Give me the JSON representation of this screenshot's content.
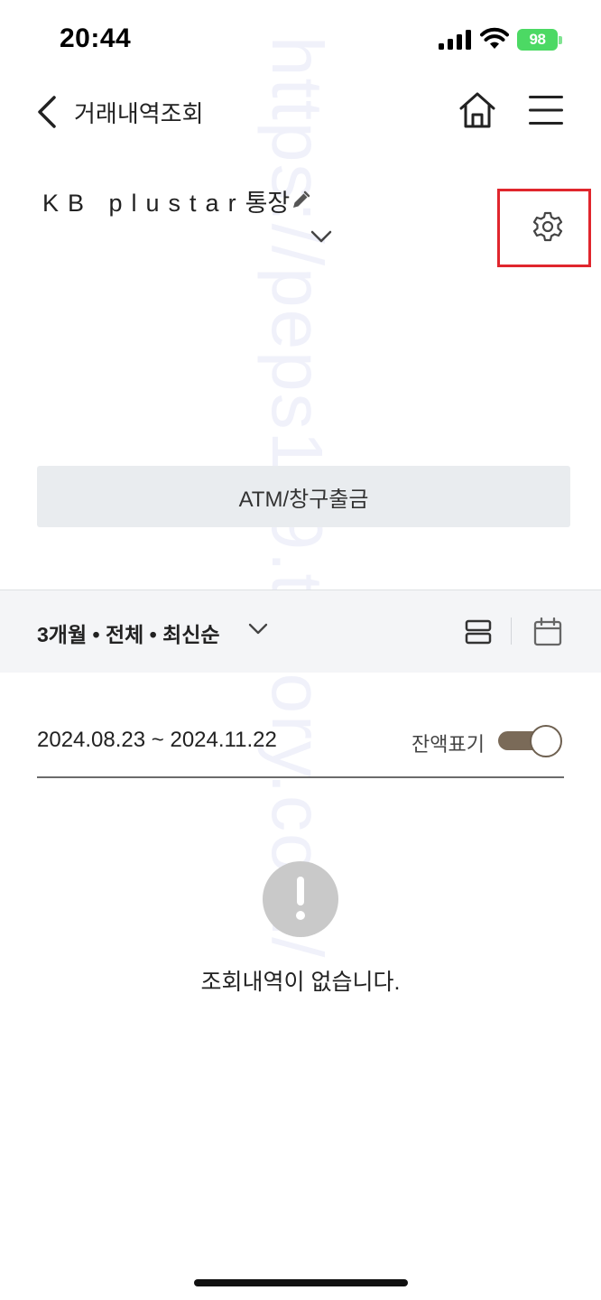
{
  "status_bar": {
    "time": "20:44",
    "battery": "98",
    "icons": [
      "signal-icon",
      "wifi-icon",
      "battery-icon"
    ]
  },
  "header": {
    "title": "거래내역조회",
    "icons": [
      "back-arrow-icon",
      "home-icon",
      "menu-icon"
    ]
  },
  "account": {
    "name_latin": "KB plustar",
    "name_korean": "통장",
    "icons": [
      "edit-pencil-icon",
      "chevron-down-icon",
      "gear-icon"
    ]
  },
  "atm_button": {
    "label": "ATM/창구출금"
  },
  "filter": {
    "summary": "3개월 • 전체 • 최신순",
    "icons": [
      "chevron-down-icon",
      "list-view-icon",
      "calendar-icon"
    ]
  },
  "date_range": {
    "text": "2024.08.23 ~ 2024.11.22",
    "balance_label": "잔액표기",
    "balance_toggle_on": true,
    "toggle_color": "#7a6a58"
  },
  "empty_state": {
    "message": "조회내역이 없습니다.",
    "icon": "exclamation-circle-icon"
  },
  "watermark": "https://peps119.tistory.com/",
  "colors": {
    "highlight_box": "#e0262d",
    "battery": "#4cd964",
    "button_bg": "#e9ecef"
  }
}
